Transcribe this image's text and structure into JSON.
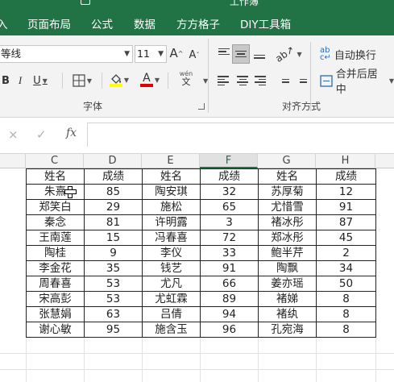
{
  "window": {
    "title": "工作簿"
  },
  "tabs": [
    {
      "label": "入"
    },
    {
      "label": "页面布局"
    },
    {
      "label": "公式"
    },
    {
      "label": "数据"
    },
    {
      "label": "方方格子"
    },
    {
      "label": "DIY工具箱"
    }
  ],
  "ribbon": {
    "font": {
      "name": "等线",
      "size": "11",
      "increase_label": "A",
      "decrease_label": "A",
      "bold": "B",
      "italic": "I",
      "underline": "U",
      "font_color_label": "A",
      "phonetic_top": "wén",
      "phonetic_bottom": "文",
      "group_label": "字体"
    },
    "alignment": {
      "wrap_text": "自动换行",
      "merge_center": "合并后居中",
      "group_label": "对齐方式"
    },
    "colors": {
      "accent": "#217346",
      "highlight": "#ffff00",
      "font_color": "#e00000"
    }
  },
  "formula_bar": {
    "cancel": "×",
    "enter": "✓",
    "fx": "fx",
    "value": ""
  },
  "columns": [
    "C",
    "D",
    "E",
    "F",
    "G",
    "H"
  ],
  "active_column": "F",
  "table": {
    "headers": [
      "姓名",
      "成绩",
      "姓名",
      "成绩",
      "姓名",
      "成绩"
    ],
    "rows": [
      [
        "朱熹",
        "85",
        "陶安琪",
        "32",
        "苏厚菊",
        "12"
      ],
      [
        "郑笑白",
        "29",
        "施松",
        "65",
        "尤惜雪",
        "91"
      ],
      [
        "秦念",
        "81",
        "许明露",
        "3",
        "褚冰彤",
        "87"
      ],
      [
        "王南莲",
        "15",
        "冯春喜",
        "72",
        "郑冰彤",
        "45"
      ],
      [
        "陶桂",
        "9",
        "李仪",
        "33",
        "鲍半芹",
        "2"
      ],
      [
        "李金花",
        "35",
        "钱艺",
        "91",
        "陶飘",
        "34"
      ],
      [
        "周春喜",
        "53",
        "尤凡",
        "66",
        "姜亦瑶",
        "50"
      ],
      [
        "宋高彭",
        "53",
        "尤虹霖",
        "89",
        "褚娣",
        "8"
      ],
      [
        "张慧娟",
        "63",
        "吕倩",
        "94",
        "褚纨",
        "8"
      ],
      [
        "谢心敏",
        "95",
        "施含玉",
        "96",
        "孔宛海",
        "8"
      ]
    ]
  }
}
